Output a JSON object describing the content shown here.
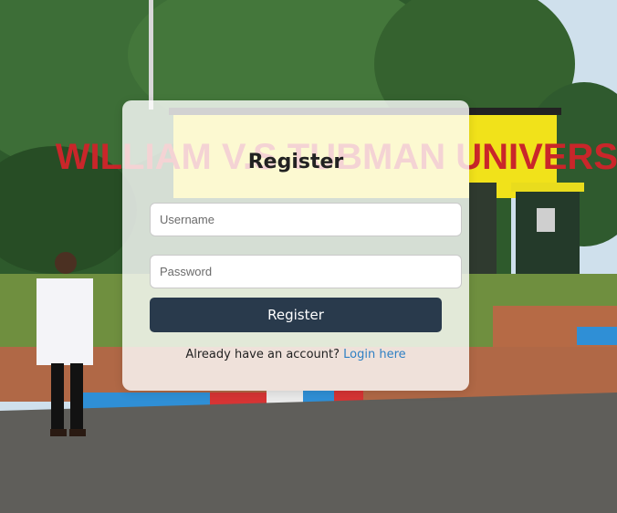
{
  "background": {
    "sign_text": "WILLIAM V.S TUBMAN UNIVERSITY",
    "sky_color": "#cfe0ec",
    "foliage_color": "#2f5a2e",
    "sign_color": "#f1e21a"
  },
  "form": {
    "title": "Register",
    "username_placeholder": "Username",
    "password_placeholder": "Password",
    "submit_label": "Register",
    "login_prompt": "Already have an account?",
    "login_link": "Login here"
  }
}
